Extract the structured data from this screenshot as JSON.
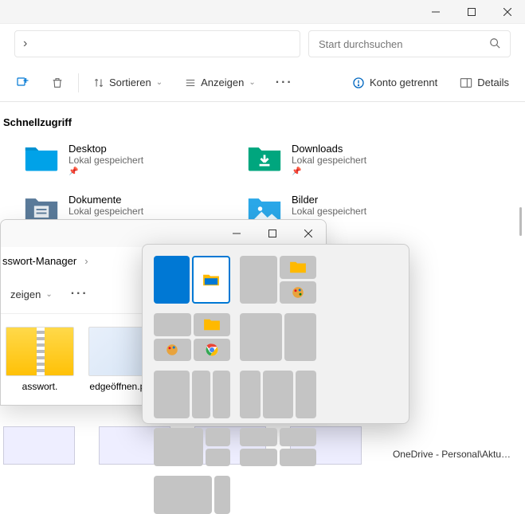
{
  "window1": {
    "search_placeholder": "Start durchsuchen",
    "toolbar": {
      "sort": "Sortieren",
      "view": "Anzeigen",
      "account": "Konto getrennt",
      "details": "Details"
    },
    "section": "Schnellzugriff",
    "quick": [
      {
        "name": "Desktop",
        "sub": "Lokal gespeichert",
        "color": "#00A2E8"
      },
      {
        "name": "Downloads",
        "sub": "Lokal gespeichert",
        "color": "#00A67E"
      },
      {
        "name": "Dokumente",
        "sub": "Lokal gespeichert",
        "color": "#5A7A99"
      },
      {
        "name": "Bilder",
        "sub": "Lokal gespeichert",
        "color": "#2AA7E8"
      }
    ]
  },
  "window2": {
    "crumb": "sswort-Manager",
    "view": "zeigen",
    "files": [
      {
        "name": "asswort.",
        "kind": "zip"
      },
      {
        "name": "edgeöffnen.png",
        "kind": "img"
      }
    ]
  },
  "status": "OneDrive - Personal\\Aktu…"
}
